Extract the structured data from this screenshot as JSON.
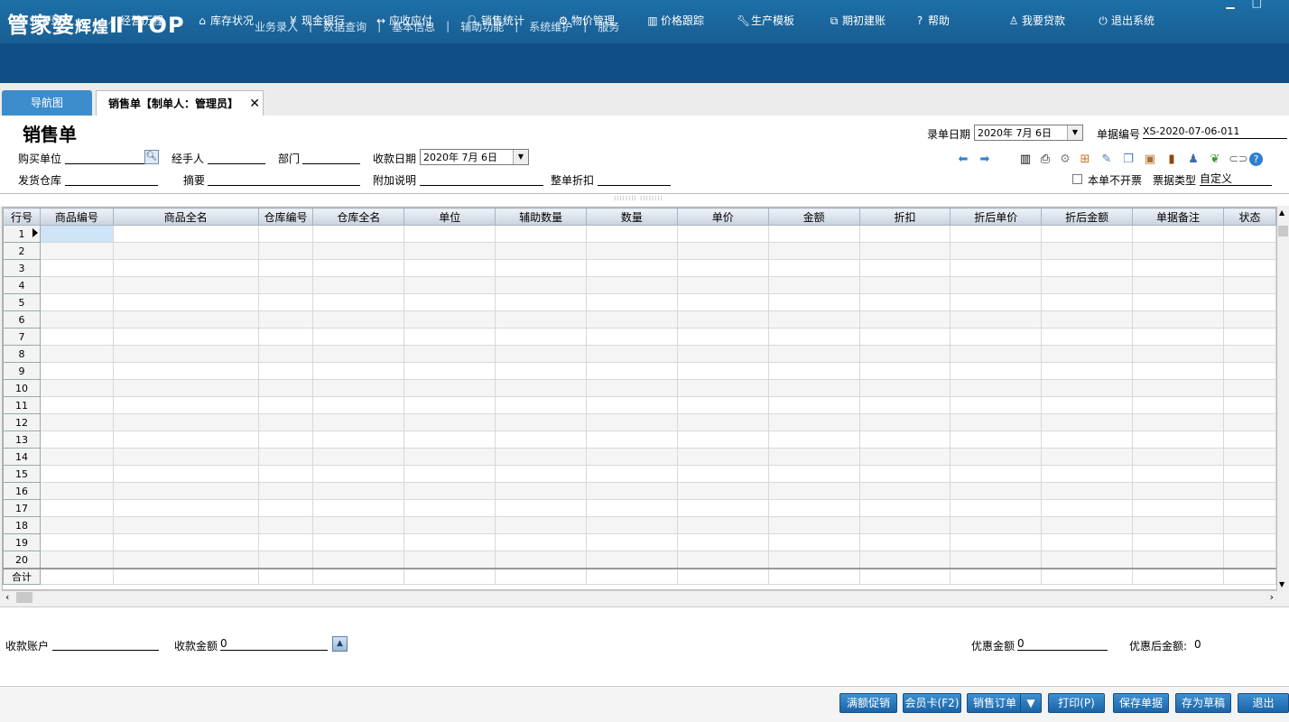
{
  "app": {
    "logo_main": "管家婆",
    "logo_sub": "辉煌",
    "logo_version": "Ⅱ TOP",
    "top_menu": [
      "业务录入",
      "数据查询",
      "基本信息",
      "辅助功能",
      "系统维护",
      "服务"
    ],
    "separator": "|"
  },
  "toolbar": [
    {
      "label": "业务录入",
      "icon": "document-edit-icon"
    },
    {
      "label": "经营历程",
      "icon": "line-chart-icon"
    },
    {
      "label": "库存状况",
      "icon": "home-icon"
    },
    {
      "label": "现金银行",
      "icon": "yen-icon"
    },
    {
      "label": "应收应付",
      "icon": "exchange-icon"
    },
    {
      "label": "销售统计",
      "icon": "search-icon"
    },
    {
      "label": "物价管理",
      "icon": "gear-icon"
    },
    {
      "label": "价格跟踪",
      "icon": "bar-chart-icon"
    },
    {
      "label": "生产模板",
      "icon": "wrench-icon"
    },
    {
      "label": "期初建账",
      "icon": "external-link-icon"
    },
    {
      "label": "帮助",
      "icon": "question-icon"
    },
    {
      "label": "我要贷款",
      "icon": "money-bag-icon"
    },
    {
      "label": "退出系统",
      "icon": "power-icon"
    }
  ],
  "tabs": {
    "nav": "导航图",
    "active": "销售单【制单人：管理员】",
    "close": "✕"
  },
  "form": {
    "title": "销售单",
    "entry_date_label": "录单日期",
    "entry_date": "2020年 7月 6日",
    "doc_no_label": "单据编号",
    "doc_no": "XS-2020-07-06-011",
    "buyer_label": "购买单位",
    "buyer": "",
    "handler_label": "经手人",
    "handler": "",
    "dept_label": "部门",
    "dept": "",
    "receipt_date_label": "收款日期",
    "receipt_date": "2020年 7月 6日",
    "warehouse_label": "发货仓库",
    "warehouse": "",
    "summary_label": "摘要",
    "summary": "",
    "note_label": "附加说明",
    "note": "",
    "discount_label": "整单折扣",
    "discount": "",
    "no_invoice_label": "本单不开票",
    "no_invoice_checked": false,
    "bill_type_label": "票据类型",
    "bill_type": "自定义"
  },
  "grid": {
    "columns": [
      "行号",
      "商品编号",
      "商品全名",
      "仓库编号",
      "仓库全名",
      "单位",
      "辅助数量",
      "数量",
      "单价",
      "金额",
      "折扣",
      "折后单价",
      "折后金额",
      "单据备注",
      "状态"
    ],
    "row_numbers": [
      "1",
      "2",
      "3",
      "4",
      "5",
      "6",
      "7",
      "8",
      "9",
      "10",
      "11",
      "12",
      "13",
      "14",
      "15",
      "16",
      "17",
      "18",
      "19",
      "20"
    ],
    "total_label": "合计"
  },
  "bottom": {
    "account_label": "收款账户",
    "account": "",
    "amount_label": "收款金额",
    "amount": "0",
    "discount_amount_label": "优惠金额",
    "discount_amount": "0",
    "after_discount_label": "优惠后金额:",
    "after_discount": "0"
  },
  "buttons": {
    "promo": "满额促销",
    "member": "会员卡(F2)",
    "sales_order": "销售订单",
    "print": "打印(P)",
    "save": "保存单据",
    "draft": "存为草稿",
    "exit": "退出"
  },
  "colors": {
    "banner": "#1d6fa8",
    "toolbar": "#0f4f86",
    "tab_nav": "#3d8ccc",
    "button": "#1b64a8"
  }
}
